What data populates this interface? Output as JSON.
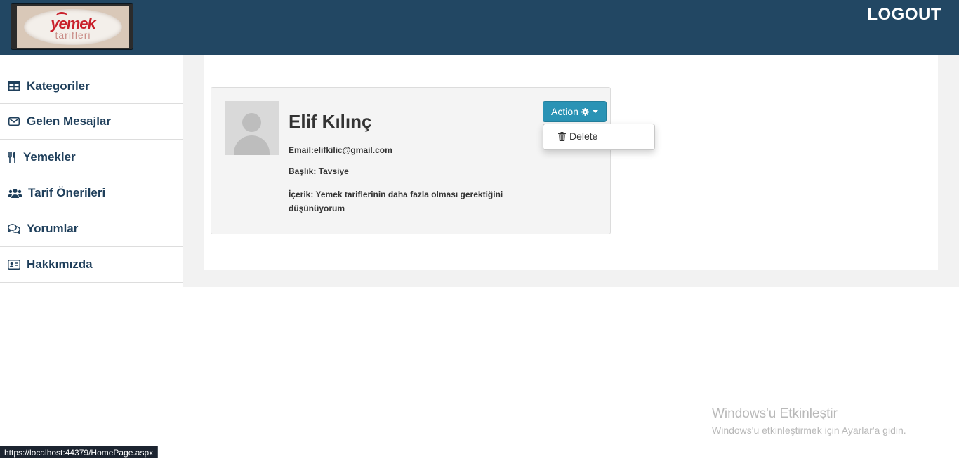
{
  "header": {
    "logo": {
      "word": "yemek",
      "sub": "tarifleri"
    },
    "logout_label": "LOGOUT",
    "background": "#224763"
  },
  "sidebar": {
    "items": [
      {
        "label": "Kategoriler",
        "icon": "table-icon"
      },
      {
        "label": "Gelen Mesajlar",
        "icon": "envelope-icon"
      },
      {
        "label": "Yemekler",
        "icon": "utensils-icon"
      },
      {
        "label": "Tarif Önerileri",
        "icon": "users-icon"
      },
      {
        "label": "Yorumlar",
        "icon": "comments-icon"
      },
      {
        "label": "Hakkımızda",
        "icon": "id-card-icon"
      }
    ]
  },
  "message": {
    "name": "Elif Kılınç",
    "email": "Email:elifkilic@gmail.com",
    "subject": "Başlık: Tavsiye",
    "content": "İçerik: Yemek tariflerinin daha fazla olması gerektiğini düşünüyorum",
    "action_label": "Action",
    "delete_label": "Delete",
    "accent": "#2a93b5"
  },
  "watermark": {
    "title": "Windows'u Etkinleştir",
    "subtitle": "Windows'u etkinleştirmek için Ayarlar'a gidin."
  },
  "statusbar": {
    "url": "https://localhost:44379/HomePage.aspx"
  }
}
